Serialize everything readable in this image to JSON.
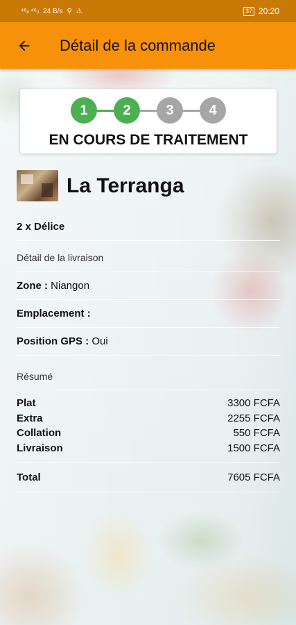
{
  "status_bar": {
    "signal_left": "⁴⁶ᵢₗ ⁴⁶ᵢₗ",
    "data_speed": "24 B/s",
    "battery": "37",
    "time": "20:20"
  },
  "app_bar": {
    "title": "Détail de la commande"
  },
  "progress": {
    "steps": [
      {
        "label": "1",
        "state": "done"
      },
      {
        "label": "2",
        "state": "done"
      },
      {
        "label": "3",
        "state": "pending"
      },
      {
        "label": "4",
        "state": "pending"
      }
    ],
    "status_text": "EN COURS DE TRAITEMENT",
    "colors": {
      "done": "#4caf50",
      "pending": "#a6a6a6"
    }
  },
  "restaurant": {
    "name": "La Terranga"
  },
  "order": {
    "item": "2 x Délice"
  },
  "delivery": {
    "section_label": "Détail de la livraison",
    "zone_label": "Zone :",
    "zone_value": "Niangon",
    "location_label": "Emplacement :",
    "location_value": "",
    "gps_label": "Position GPS :",
    "gps_value": "Oui"
  },
  "summary": {
    "section_label": "Résumé",
    "lines": [
      {
        "label": "Plat",
        "value": "3300 FCFA"
      },
      {
        "label": "Extra",
        "value": "2255 FCFA"
      },
      {
        "label": "Collation",
        "value": "550 FCFA"
      },
      {
        "label": "Livraison",
        "value": "1500 FCFA"
      }
    ],
    "total_label": "Total",
    "total_value": "7605 FCFA"
  },
  "colors": {
    "app_bar": "#f7910a",
    "status_bar": "#c97a06"
  }
}
